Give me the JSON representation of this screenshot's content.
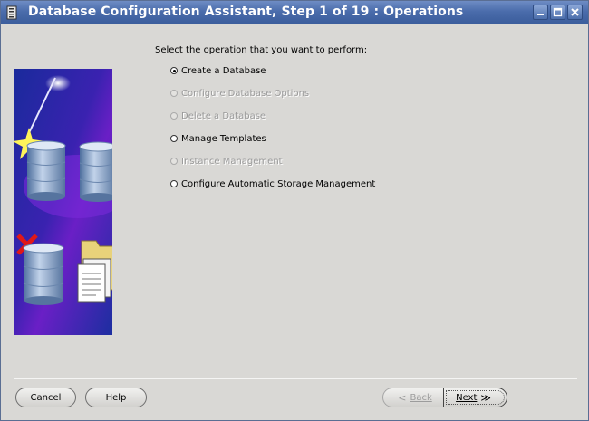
{
  "window": {
    "title": "Database Configuration Assistant, Step 1 of 19 : Operations"
  },
  "main": {
    "prompt": "Select the operation that you want to perform:",
    "options": [
      {
        "label": "Create a Database",
        "selected": true,
        "enabled": true
      },
      {
        "label": "Configure Database Options",
        "selected": false,
        "enabled": false
      },
      {
        "label": "Delete a Database",
        "selected": false,
        "enabled": false
      },
      {
        "label": "Manage Templates",
        "selected": false,
        "enabled": true
      },
      {
        "label": "Instance Management",
        "selected": false,
        "enabled": false
      },
      {
        "label": "Configure Automatic Storage Management",
        "selected": false,
        "enabled": true
      }
    ]
  },
  "footer": {
    "cancel_label": "Cancel",
    "help_label": "Help",
    "back_label": "Back",
    "back_arrow": "<",
    "next_label": "Next",
    "next_arrow": "≫"
  },
  "colors": {
    "titlebar": "#4a6cab",
    "background": "#d9d8d5",
    "banner_blue": "#1b2fa0",
    "banner_purple": "#5a1bb8",
    "disabled_text": "#9a9a9a"
  },
  "icons": [
    "app-icon",
    "minimize-icon",
    "maximize-icon",
    "close-icon",
    "wizard-banner"
  ]
}
